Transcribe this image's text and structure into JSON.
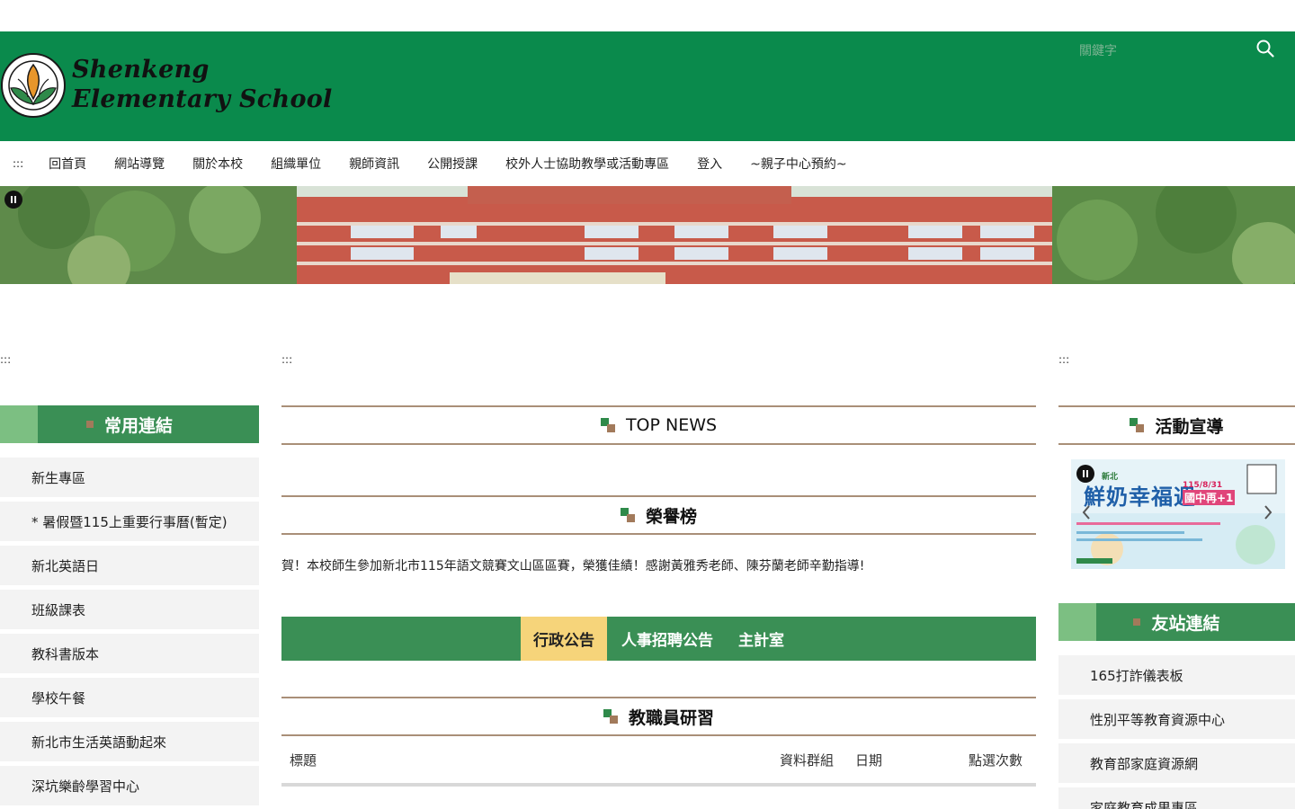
{
  "header": {
    "title_line1": "Shenkeng",
    "title_line2": "Elementary School",
    "search_placeholder": "關鍵字",
    "background_color": "#0a8a4c"
  },
  "nav": {
    "access_key": ":::",
    "items": [
      "回首頁",
      "網站導覽",
      "關於本校",
      "組織單位",
      "親師資訊",
      "公開授課",
      "校外人士協助教學或活動專區",
      "登入",
      "~親子中心預約~"
    ]
  },
  "access_keys": {
    "left": ":::",
    "center": ":::",
    "right": ":::"
  },
  "left": {
    "heading": "常用連結",
    "links": [
      "新生專區",
      "* 暑假暨115上重要行事曆(暫定)",
      "新北英語日",
      "班級課表",
      "教科書版本",
      "學校午餐",
      "新北市生活英語動起來",
      "深坑樂齡學習中心"
    ]
  },
  "main": {
    "top_news_heading": "TOP NEWS",
    "honor_heading": "榮譽榜",
    "honor_text": "賀！本校師生參加新北市115年語文競賽文山區區賽，榮獲佳績！感謝黃雅秀老師、陳芬蘭老師辛勤指導!",
    "tabs": [
      {
        "label": "行政公告",
        "active": true
      },
      {
        "label": "人事招聘公告",
        "active": false
      },
      {
        "label": "主計室",
        "active": false
      }
    ],
    "training_heading": "教職員研習",
    "table_headers": {
      "title": "標題",
      "group": "資料群組",
      "date": "日期",
      "clicks": "點選次數"
    }
  },
  "right": {
    "activity_heading": "活動宣導",
    "promo": {
      "title": "鮮奶幸福週",
      "region": "新北",
      "date_text": "115/8/31",
      "tagline": "國中再+1"
    },
    "friends_heading": "友站連結",
    "friend_links": [
      "165打詐儀表板",
      "性別平等教育資源中心",
      "教育部家庭資源網",
      "家庭教育成果專區"
    ]
  },
  "colors": {
    "accent_green": "#3a8f55",
    "header_green": "#0a8a4c",
    "active_tab": "#f6d47a",
    "divider_brown": "#a98f78"
  }
}
